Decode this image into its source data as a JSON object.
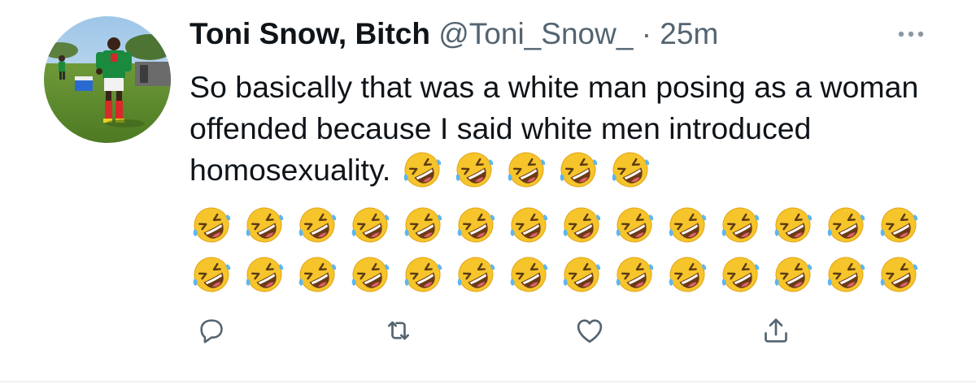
{
  "tweet": {
    "display_name": "Toni Snow, Bitch",
    "handle": "@Toni_Snow_",
    "separator": "·",
    "timestamp": "25m",
    "text": "So basically that was a white man posing as a woman offended because I said white men introduced homosexuality.",
    "emoji": {
      "name": "rolling-on-the-floor-laughing",
      "inline_count": 5,
      "row_count": 14,
      "rows": 2
    }
  },
  "actions": {
    "reply_icon": "reply-icon",
    "retweet_icon": "retweet-icon",
    "like_icon": "like-icon",
    "share_icon": "share-icon"
  },
  "colors": {
    "text": "#0f1419",
    "secondary": "#536471",
    "divider": "#eff3f4",
    "emoji_face": "#f6c42b"
  }
}
